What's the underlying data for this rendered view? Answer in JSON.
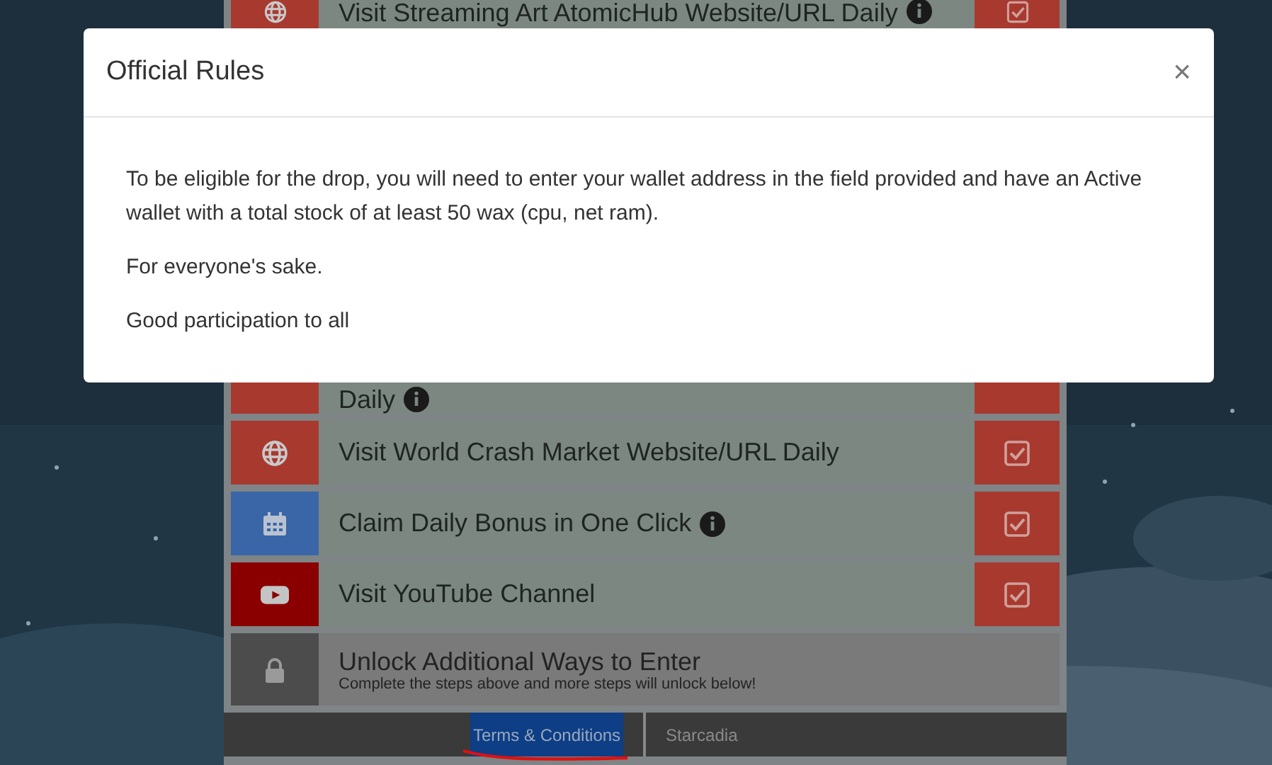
{
  "entries": [
    {
      "kind": "globe",
      "text": "Visit Streaming Art AtomicHub Website/URL Daily",
      "info": true
    },
    {
      "kind": "covered",
      "text": "Daily",
      "info": true
    },
    {
      "kind": "globe",
      "text": "Visit World Crash Market Website/URL Daily",
      "info": false
    },
    {
      "kind": "calendar",
      "text": "Claim Daily Bonus in One Click",
      "info": true
    },
    {
      "kind": "youtube",
      "text": "Visit YouTube Channel",
      "info": false
    }
  ],
  "unlock": {
    "title": "Unlock Additional Ways to Enter",
    "subtitle": "Complete the steps above and more steps will unlock below!"
  },
  "footer_links": [
    {
      "label": "Terms & Conditions",
      "selected": true
    },
    {
      "label": "Starcadia",
      "selected": false
    }
  ],
  "modal": {
    "title": "Official Rules",
    "close": "×",
    "paragraphs": [
      "To be eligible for the drop, you will need to enter your wallet address in the field provided and have an Active wallet with a total stock of at least 50 wax (cpu, net ram).",
      "For everyone's sake.",
      "Good participation to all"
    ]
  }
}
